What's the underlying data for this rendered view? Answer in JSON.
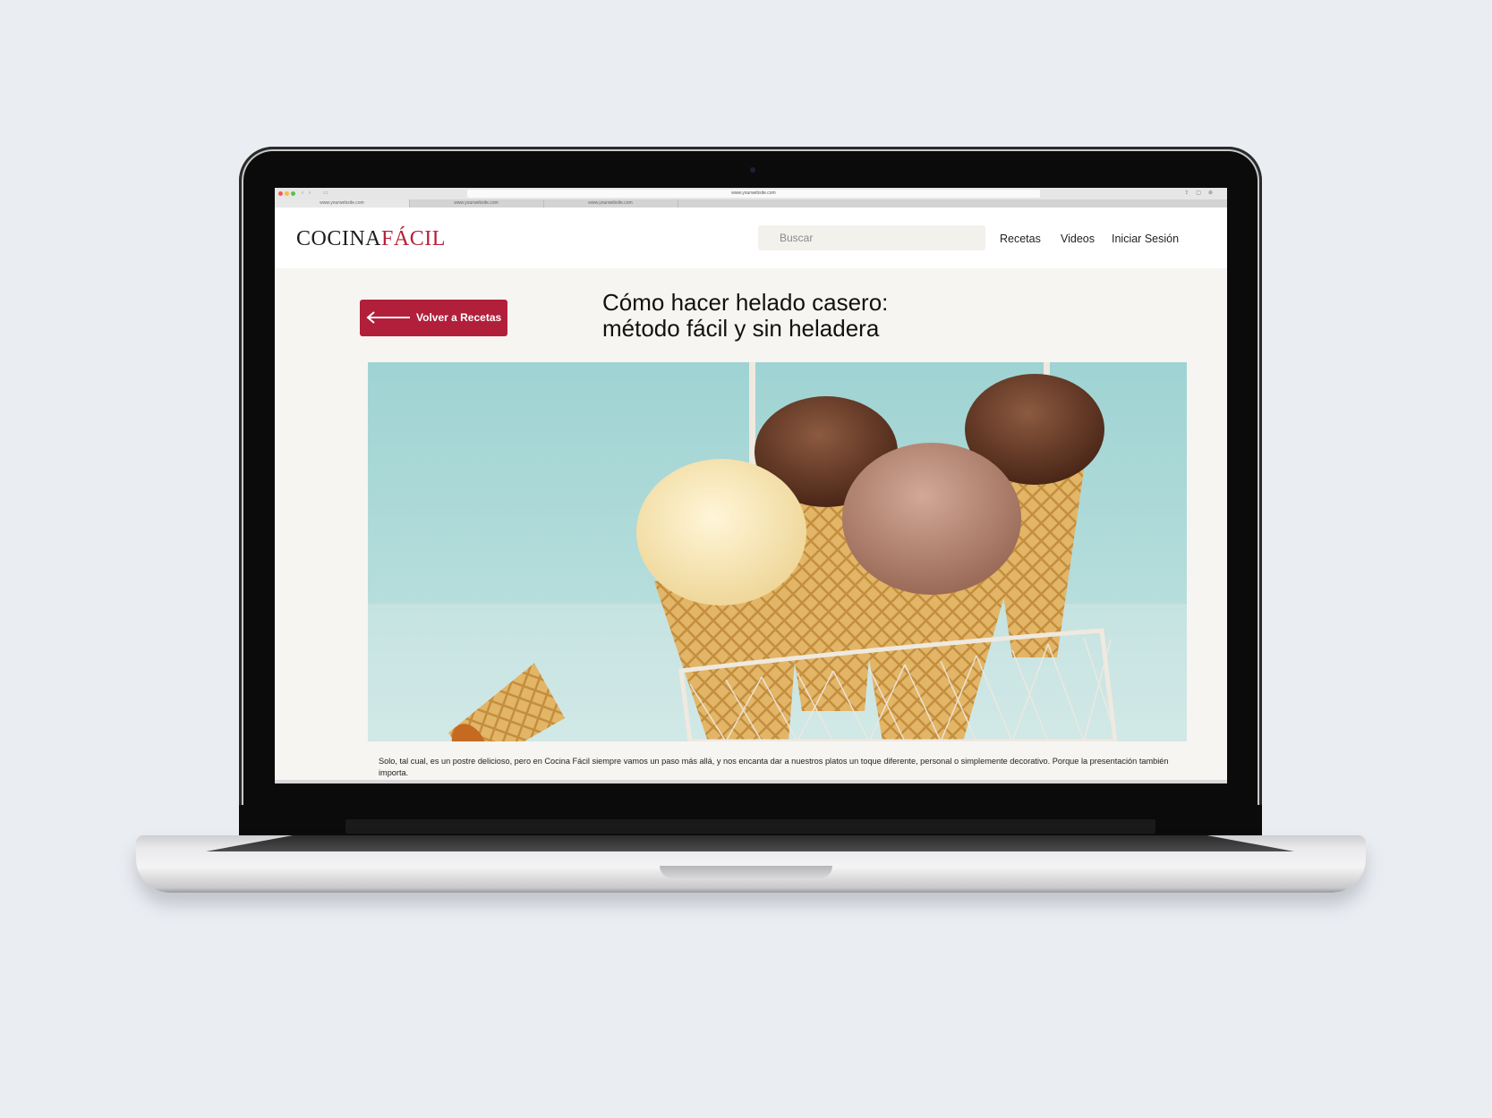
{
  "browser": {
    "url": "www.yourwebsite.com",
    "tabs": [
      "www.yourwebsite.com",
      "www.yourwebsite.com",
      "www.yourwebsite.com"
    ]
  },
  "header": {
    "logo_main": "COCINA",
    "logo_accent": "FÁCIL",
    "search_placeholder": "Buscar",
    "nav": {
      "recetas": "Recetas",
      "videos": "Videos",
      "login": "Iniciar Sesión"
    }
  },
  "article": {
    "back_label": "Volver a Recetas",
    "title_line1": "Cómo hacer helado casero:",
    "title_line2": "método fácil y sin heladera",
    "intro": "Solo, tal cual, es un postre delicioso, pero en Cocina Fácil siempre vamos un paso más allá, y nos encanta dar a nuestros platos un toque diferente, personal o simplemente decorativo. Porque la presentación también importa."
  },
  "colors": {
    "brand_red": "#b21f3a",
    "page_bg": "#f6f5f1",
    "header_bg": "#ffffff"
  },
  "icons": [
    "arrow-left-icon",
    "search-icon",
    "camera-icon"
  ]
}
